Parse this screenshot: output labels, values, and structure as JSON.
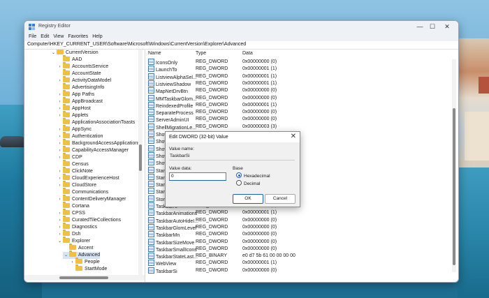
{
  "window": {
    "title": "Registry Editor",
    "controls": {
      "minimize": "—",
      "maximize": "☐",
      "close": "✕"
    },
    "menu": [
      "File",
      "Edit",
      "View",
      "Favorites",
      "Help"
    ],
    "address": "Computer\\HKEY_CURRENT_USER\\Software\\Microsoft\\Windows\\CurrentVersion\\Explorer\\Advanced"
  },
  "tree": {
    "items": [
      {
        "label": "CurrentVersion",
        "chev": "⌄",
        "level": 0
      },
      {
        "label": "AAD",
        "chev": "",
        "level": 1
      },
      {
        "label": "AccountsService",
        "chev": "›",
        "level": 1
      },
      {
        "label": "AccountState",
        "chev": "",
        "level": 1
      },
      {
        "label": "ActivityDataModel",
        "chev": "›",
        "level": 1
      },
      {
        "label": "AdvertisingInfo",
        "chev": "",
        "level": 1
      },
      {
        "label": "App Paths",
        "chev": "›",
        "level": 1
      },
      {
        "label": "AppBroadcast",
        "chev": "›",
        "level": 1
      },
      {
        "label": "AppHost",
        "chev": "›",
        "level": 1
      },
      {
        "label": "Applets",
        "chev": "›",
        "level": 1
      },
      {
        "label": "ApplicationAssociationToasts",
        "chev": "",
        "level": 1
      },
      {
        "label": "AppSync",
        "chev": "›",
        "level": 1
      },
      {
        "label": "Authentication",
        "chev": "›",
        "level": 1
      },
      {
        "label": "BackgroundAccessApplications",
        "chev": "›",
        "level": 1
      },
      {
        "label": "CapabilityAccessManager",
        "chev": "›",
        "level": 1
      },
      {
        "label": "CDP",
        "chev": "›",
        "level": 1
      },
      {
        "label": "Census",
        "chev": "",
        "level": 1
      },
      {
        "label": "ClickNote",
        "chev": "›",
        "level": 1
      },
      {
        "label": "CloudExperienceHost",
        "chev": "›",
        "level": 1
      },
      {
        "label": "CloudStore",
        "chev": "›",
        "level": 1
      },
      {
        "label": "Communications",
        "chev": "",
        "level": 1
      },
      {
        "label": "ContentDeliveryManager",
        "chev": "›",
        "level": 1
      },
      {
        "label": "Cortana",
        "chev": "",
        "level": 1
      },
      {
        "label": "CPSS",
        "chev": "›",
        "level": 1
      },
      {
        "label": "CuratedTileCollections",
        "chev": "›",
        "level": 1
      },
      {
        "label": "Diagnostics",
        "chev": "›",
        "level": 1
      },
      {
        "label": "Dsh",
        "chev": "›",
        "level": 1
      },
      {
        "label": "Explorer",
        "chev": "⌄",
        "level": 1
      },
      {
        "label": "Accent",
        "chev": "",
        "level": 2
      },
      {
        "label": "Advanced",
        "chev": "⌄",
        "level": 2,
        "selected": true
      },
      {
        "label": "People",
        "chev": "›",
        "level": 3
      },
      {
        "label": "StartMode",
        "chev": "",
        "level": 3
      }
    ]
  },
  "list": {
    "headers": {
      "name": "Name",
      "type": "Type",
      "data": "Data"
    },
    "rows": [
      {
        "name": "IconsOnly",
        "type": "REG_DWORD",
        "data": "0x00000000 (0)"
      },
      {
        "name": "LaunchTo",
        "type": "REG_DWORD",
        "data": "0x00000001 (1)"
      },
      {
        "name": "ListviewAlphaSel...",
        "type": "REG_DWORD",
        "data": "0x00000001 (1)"
      },
      {
        "name": "ListviewShadow",
        "type": "REG_DWORD",
        "data": "0x00000001 (1)"
      },
      {
        "name": "MapNetDrvBtn",
        "type": "REG_DWORD",
        "data": "0x00000000 (0)"
      },
      {
        "name": "MMTaskbarGlom...",
        "type": "REG_DWORD",
        "data": "0x00000000 (0)"
      },
      {
        "name": "ReindexedProfile",
        "type": "REG_DWORD",
        "data": "0x00000001 (1)"
      },
      {
        "name": "SeparateProcess",
        "type": "REG_DWORD",
        "data": "0x00000000 (0)"
      },
      {
        "name": "ServerAdminUI",
        "type": "REG_DWORD",
        "data": "0x00000000 (0)"
      },
      {
        "name": "ShellMigrationLe...",
        "type": "REG_DWORD",
        "data": "0x00000003 (3)"
      },
      {
        "name": "ShowCompColor",
        "type": "",
        "data": ""
      },
      {
        "name": "Show",
        "type": "",
        "data": ""
      },
      {
        "name": "Show",
        "type": "",
        "data": ""
      },
      {
        "name": "Show",
        "type": "",
        "data": ""
      },
      {
        "name": "Show",
        "type": "",
        "data": ""
      },
      {
        "name": "Start_",
        "type": "",
        "data": ""
      },
      {
        "name": "Start_",
        "type": "",
        "data": ""
      },
      {
        "name": "StartM",
        "type": "",
        "data": ""
      },
      {
        "name": "StartS",
        "type": "",
        "data": ""
      },
      {
        "name": "Store",
        "type": "",
        "data": ""
      },
      {
        "name": "TaskbarAl",
        "type": "REG_DWORD",
        "data": "0x00000001 (1)"
      },
      {
        "name": "TaskbarAnimations",
        "type": "REG_DWORD",
        "data": "0x00000001 (1)"
      },
      {
        "name": "TaskbarAutoHideI...",
        "type": "REG_DWORD",
        "data": "0x00000000 (0)"
      },
      {
        "name": "TaskbarGlomLevel",
        "type": "REG_DWORD",
        "data": "0x00000000 (0)"
      },
      {
        "name": "TaskbarMn",
        "type": "REG_DWORD",
        "data": "0x00000000 (0)"
      },
      {
        "name": "TaskbarSizeMove",
        "type": "REG_DWORD",
        "data": "0x00000000 (0)"
      },
      {
        "name": "TaskbarSmallIcons",
        "type": "REG_DWORD",
        "data": "0x00000000 (0)"
      },
      {
        "name": "TaskbarStateLast...",
        "type": "REG_BINARY",
        "data": "e0 d7 5b 61 00 00 00 00"
      },
      {
        "name": "WebView",
        "type": "REG_DWORD",
        "data": "0x00000001 (1)"
      },
      {
        "name": "TaskbarSi",
        "type": "REG_DWORD",
        "data": "0x00000000 (0)"
      }
    ]
  },
  "dialog": {
    "title": "Edit DWORD (32-bit) Value",
    "close": "✕",
    "value_name_label": "Value name:",
    "value_name": "TaskbarSi",
    "value_data_label": "Value data:",
    "value_data": "0",
    "base_label": "Base",
    "hex_label": "Hexadecimal",
    "dec_label": "Decimal",
    "ok": "OK",
    "cancel": "Cancel"
  }
}
